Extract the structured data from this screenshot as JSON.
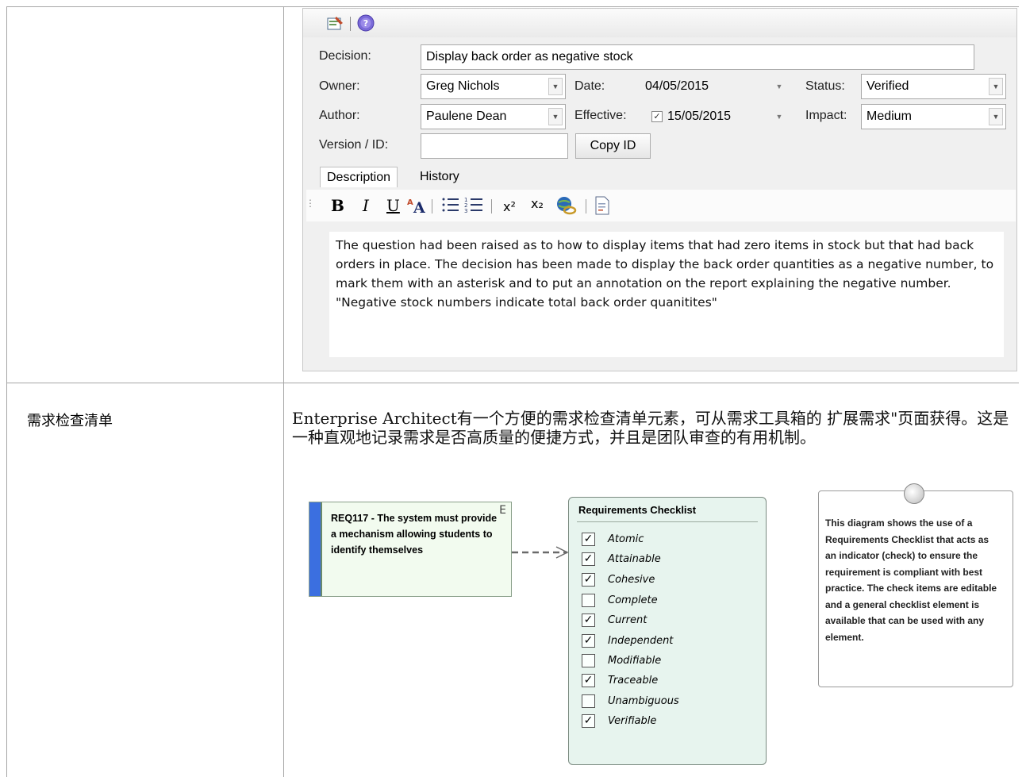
{
  "decision_dialog": {
    "labels": {
      "decision": "Decision:",
      "owner": "Owner:",
      "author": "Author:",
      "version": "Version / ID:",
      "date": "Date:",
      "effective": "Effective:",
      "status": "Status:",
      "impact": "Impact:"
    },
    "values": {
      "decision": "Display back order as negative stock",
      "owner": "Greg Nichols",
      "author": "Paulene Dean",
      "version": "",
      "date": "04/05/2015",
      "effective": "15/05/2015",
      "effective_checked": true,
      "status": "Verified",
      "impact": "Medium"
    },
    "copy_id_label": "Copy ID",
    "tabs": [
      "Description",
      "History"
    ],
    "toolbar_icons": [
      "properties-icon",
      "help-icon"
    ],
    "editor_toolbar": {
      "bold": "B",
      "italic": "I",
      "underline": "U",
      "bullets_icon": "bulleted-list-icon",
      "numbering_icon": "numbered-list-icon",
      "superscript": "x²",
      "subscript": "x₂",
      "hyperlink_icon": "hyperlink-icon",
      "document_icon": "document-icon"
    },
    "description": "The question had been raised as to how to display items that had zero items in stock but that had back orders in place. The decision has been made to display the back order quantities as a negative number, to mark them with an asterisk and to put an annotation on the report explaining the negative number. \"Negative stock numbers indicate total back order quanitites\""
  },
  "row2": {
    "label": "需求检查清单",
    "paragraph": "Enterprise Architect有一个方便的需求检查清单元素，可从需求工具箱的 扩展需求\"页面获得。这是一种直观地记录需求是否高质量的便捷方式，并且是团队审查的有用机制。"
  },
  "diagram": {
    "requirement": {
      "text": "REQ117 - The system must provide a mechanism allowing students to identify themselves",
      "marker": "E"
    },
    "checklist": {
      "title": "Requirements Checklist",
      "items": [
        {
          "label": "Atomic",
          "checked": true
        },
        {
          "label": "Attainable",
          "checked": true
        },
        {
          "label": "Cohesive",
          "checked": true
        },
        {
          "label": "Complete",
          "checked": false
        },
        {
          "label": "Current",
          "checked": true
        },
        {
          "label": "Independent",
          "checked": true
        },
        {
          "label": "Modifiable",
          "checked": false
        },
        {
          "label": "Traceable",
          "checked": true
        },
        {
          "label": "Unambiguous",
          "checked": false
        },
        {
          "label": "Verifiable",
          "checked": true
        }
      ]
    },
    "note": "This diagram shows the use of a Requirements Checklist that acts as an indicator (check) to ensure the requirement is compliant with best practice. The check items are editable and a general checklist element is available that can be used with any element."
  }
}
